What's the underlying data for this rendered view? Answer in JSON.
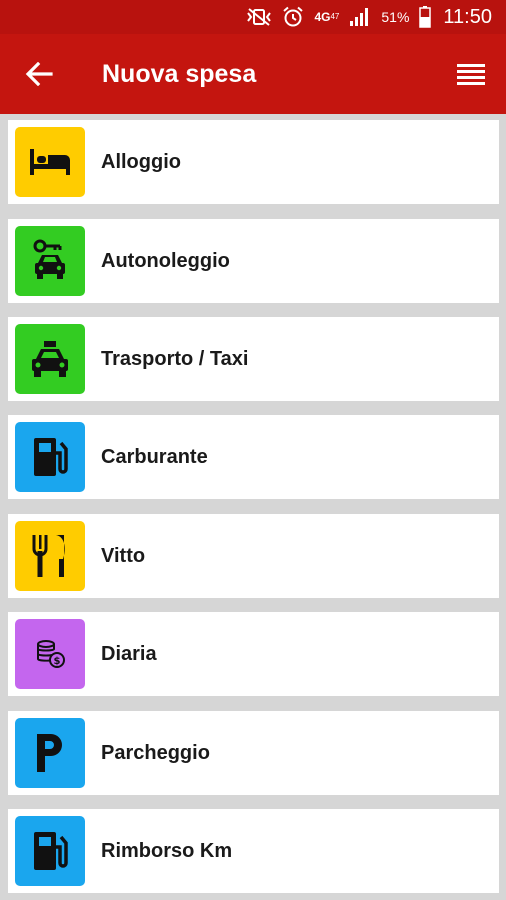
{
  "status_bar": {
    "network": "4G",
    "network_sub": "47",
    "battery": "51%",
    "time": "11:50",
    "icons": [
      "vibrate-off-icon",
      "alarm-icon",
      "network-4g-icon",
      "signal-icon",
      "battery-icon"
    ]
  },
  "app_bar": {
    "title": "Nuova spesa",
    "back_icon": "arrow-left-icon",
    "menu_icon": "list-menu-icon",
    "color": "#c4150f"
  },
  "categories": [
    {
      "label": "Alloggio",
      "icon": "bed-icon",
      "color": "#ffcc00"
    },
    {
      "label": "Autonoleggio",
      "icon": "car-key-icon",
      "color": "#33cc22"
    },
    {
      "label": "Trasporto / Taxi",
      "icon": "taxi-icon",
      "color": "#33cc22"
    },
    {
      "label": "Carburante",
      "icon": "fuel-pump-icon",
      "color": "#1aa6ee"
    },
    {
      "label": "Vitto",
      "icon": "cutlery-icon",
      "color": "#ffcc00"
    },
    {
      "label": "Diaria",
      "icon": "coins-icon",
      "color": "#c466ee"
    },
    {
      "label": "Parcheggio",
      "icon": "parking-icon",
      "color": "#1aa6ee"
    },
    {
      "label": "Rimborso Km",
      "icon": "fuel-pump-icon",
      "color": "#1aa6ee"
    }
  ]
}
